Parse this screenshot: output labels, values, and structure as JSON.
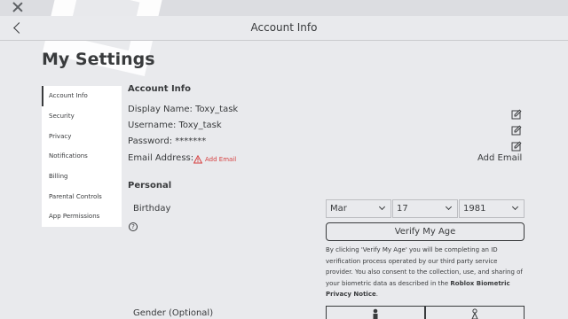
{
  "window": {
    "close_icon": "close-icon"
  },
  "header": {
    "title": "Account Info",
    "back_icon": "back-arrow-icon"
  },
  "page": {
    "title": "My Settings"
  },
  "sidebar": {
    "items": [
      {
        "label": "Account Info",
        "active": true
      },
      {
        "label": "Security"
      },
      {
        "label": "Privacy"
      },
      {
        "label": "Notifications"
      },
      {
        "label": "Billing"
      },
      {
        "label": "Parental Controls"
      },
      {
        "label": "App Permissions"
      }
    ]
  },
  "account_info": {
    "section_title": "Account Info",
    "display_name": "Display Name: Toxy_task",
    "username": "Username: Toxy_task",
    "password": "Password: *******",
    "email_label": "Email Address:",
    "email_warning": "Add Email",
    "add_email_button": "Add Email"
  },
  "personal": {
    "section_title": "Personal",
    "birthday_label": "Birthday",
    "help_glyph": "?",
    "month": "Mar",
    "day": "17",
    "year": "1981",
    "verify_button": "Verify My Age",
    "disclaimer_text": "By clicking 'Verify My Age' you will be completing an ID verification process operated by our third party service provider. You also consent to the collection, use, and sharing of your biometric data as described in the ",
    "disclaimer_link": "Roblox Biometric Privacy Notice",
    "disclaimer_end": ".",
    "gender_label": "Gender (Optional)"
  },
  "colors": {
    "accent_warning": "#d63f3f",
    "background": "#e9eaed",
    "text": "#393b3d"
  }
}
